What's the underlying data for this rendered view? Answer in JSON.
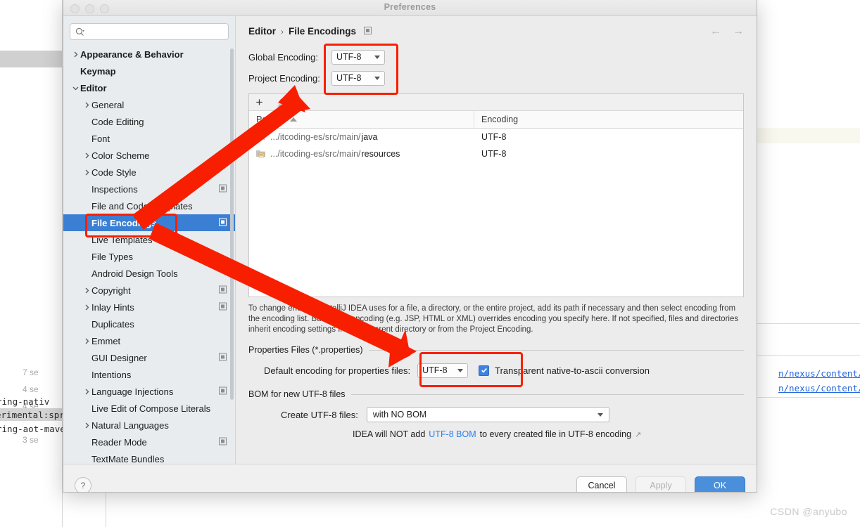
{
  "window": {
    "title": "Preferences"
  },
  "search": {
    "placeholder": "",
    "icon": "search-icon"
  },
  "sidebar": {
    "items": [
      {
        "label": "Appearance & Behavior",
        "level": 0,
        "arrow": "right",
        "cfg": false,
        "selected": false
      },
      {
        "label": "Keymap",
        "level": 0,
        "arrow": "none",
        "cfg": false,
        "selected": false
      },
      {
        "label": "Editor",
        "level": 0,
        "arrow": "down",
        "cfg": false,
        "selected": false
      },
      {
        "label": "General",
        "level": 1,
        "arrow": "right",
        "cfg": false,
        "selected": false
      },
      {
        "label": "Code Editing",
        "level": 1,
        "arrow": "none",
        "cfg": false,
        "selected": false
      },
      {
        "label": "Font",
        "level": 1,
        "arrow": "none",
        "cfg": false,
        "selected": false
      },
      {
        "label": "Color Scheme",
        "level": 1,
        "arrow": "right",
        "cfg": false,
        "selected": false
      },
      {
        "label": "Code Style",
        "level": 1,
        "arrow": "right",
        "cfg": false,
        "selected": false
      },
      {
        "label": "Inspections",
        "level": 1,
        "arrow": "none",
        "cfg": true,
        "selected": false
      },
      {
        "label": "File and Code Templates",
        "level": 1,
        "arrow": "none",
        "cfg": false,
        "selected": false
      },
      {
        "label": "File Encodings",
        "level": 1,
        "arrow": "none",
        "cfg": true,
        "selected": true
      },
      {
        "label": "Live Templates",
        "level": 1,
        "arrow": "none",
        "cfg": false,
        "selected": false
      },
      {
        "label": "File Types",
        "level": 1,
        "arrow": "none",
        "cfg": false,
        "selected": false
      },
      {
        "label": "Android Design Tools",
        "level": 1,
        "arrow": "none",
        "cfg": false,
        "selected": false
      },
      {
        "label": "Copyright",
        "level": 1,
        "arrow": "right",
        "cfg": true,
        "selected": false
      },
      {
        "label": "Inlay Hints",
        "level": 1,
        "arrow": "right",
        "cfg": true,
        "selected": false
      },
      {
        "label": "Duplicates",
        "level": 1,
        "arrow": "none",
        "cfg": false,
        "selected": false
      },
      {
        "label": "Emmet",
        "level": 1,
        "arrow": "right",
        "cfg": false,
        "selected": false
      },
      {
        "label": "GUI Designer",
        "level": 1,
        "arrow": "none",
        "cfg": true,
        "selected": false
      },
      {
        "label": "Intentions",
        "level": 1,
        "arrow": "none",
        "cfg": false,
        "selected": false
      },
      {
        "label": "Language Injections",
        "level": 1,
        "arrow": "right",
        "cfg": true,
        "selected": false
      },
      {
        "label": "Live Edit of Compose Literals",
        "level": 1,
        "arrow": "none",
        "cfg": false,
        "selected": false
      },
      {
        "label": "Natural Languages",
        "level": 1,
        "arrow": "right",
        "cfg": false,
        "selected": false
      },
      {
        "label": "Reader Mode",
        "level": 1,
        "arrow": "none",
        "cfg": true,
        "selected": false
      },
      {
        "label": "TextMate Bundles",
        "level": 1,
        "arrow": "none",
        "cfg": false,
        "selected": false
      }
    ]
  },
  "breadcrumb": {
    "parent": "Editor",
    "separator": "›",
    "current": "File Encodings",
    "nav_back": "←",
    "nav_forward": "→"
  },
  "encodings": {
    "global_label": "Global Encoding:",
    "global_value": "UTF-8",
    "project_label": "Project Encoding:",
    "project_value": "UTF-8"
  },
  "table": {
    "toolbar": {
      "add": "+",
      "edit": "pencil-icon"
    },
    "columns": [
      "Path",
      "Encoding"
    ],
    "rows": [
      {
        "icon": "folder-java-icon",
        "path": ".../itcoding-es/src/main/",
        "leaf": "java",
        "encoding": "UTF-8"
      },
      {
        "icon": "folder-resources-icon",
        "path": ".../itcoding-es/src/main/",
        "leaf": "resources",
        "encoding": "UTF-8"
      }
    ]
  },
  "hint": "To change encoding IntelliJ IDEA uses for a file, a directory, or the entire project, add its path if necessary and then select encoding from the encoding list. Built-in file encoding (e.g. JSP, HTML or XML) overrides encoding you specify here. If not specified, files and directories inherit encoding settings from the parent directory or from the Project Encoding.",
  "properties_section": {
    "title": "Properties Files (*.properties)",
    "default_label": "Default encoding for properties files:",
    "default_value": "UTF-8",
    "checkbox_label": "Transparent native-to-ascii conversion",
    "checkbox_checked": true
  },
  "bom_section": {
    "title": "BOM for new UTF-8 files",
    "create_label": "Create UTF-8 files:",
    "create_value": "with NO BOM",
    "note_prefix": "IDEA will NOT add",
    "note_link": "UTF-8 BOM",
    "note_suffix": "to every created file in UTF-8 encoding",
    "external_icon": "↗"
  },
  "footer": {
    "help": "?",
    "cancel": "Cancel",
    "apply": "Apply",
    "ok": "OK"
  },
  "background": {
    "left_texts": [
      "7 se",
      "4 se",
      "4 se",
      "3 se"
    ],
    "left_code": [
      "ring-nativ",
      "erimental:sprin",
      "ring-aot-mave"
    ],
    "right_links": [
      "n/nexus/content/grou",
      "n/nexus/content/grou"
    ]
  },
  "watermark": "CSDN @anyubo",
  "colors": {
    "accent": "#3b7fd4",
    "primary_button": "#4a8fdc",
    "annotation": "#f81f00",
    "link": "#2d7ff0"
  }
}
